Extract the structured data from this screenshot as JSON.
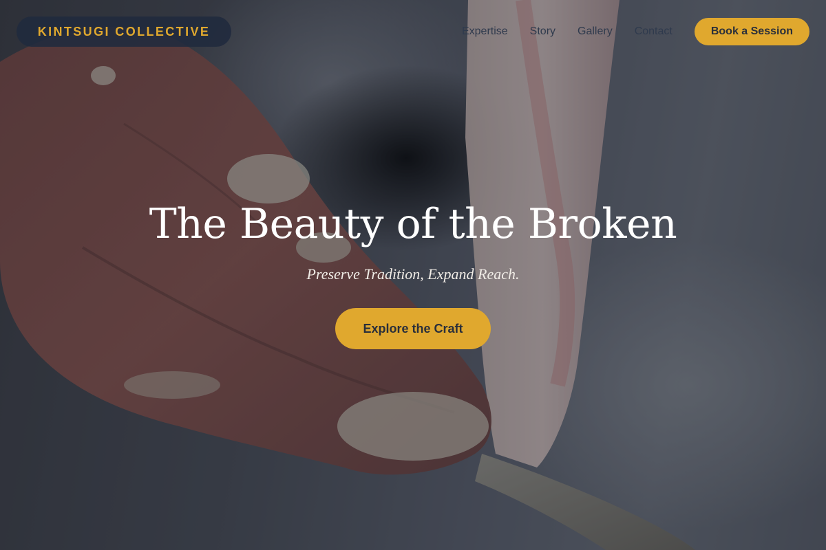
{
  "brand": {
    "name": "KINTSUGI COLLECTIVE"
  },
  "nav": {
    "links": [
      "Expertise",
      "Story",
      "Gallery",
      "Contact"
    ],
    "cta_label": "Book a Session"
  },
  "hero": {
    "headline": "The Beauty of the Broken",
    "tagline": "Preserve Tradition, Expand Reach.",
    "cta_label": "Explore the Craft",
    "background_image": "hands-shaping-clay-on-pottery-wheel"
  },
  "colors": {
    "accent_gold": "#e0a82e",
    "brand_pill_bg": "#202a3e",
    "nav_text": "#2f3a4d",
    "headline_text": "#ffffff"
  }
}
